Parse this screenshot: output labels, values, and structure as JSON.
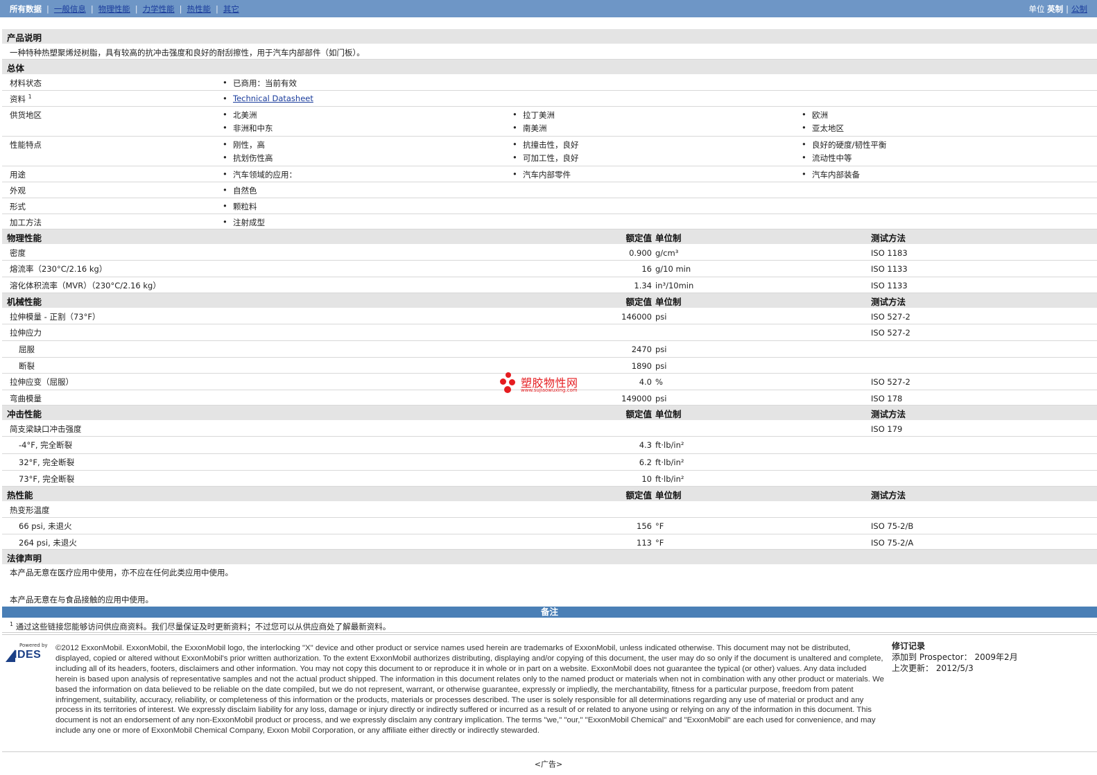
{
  "nav": {
    "tabs": [
      "所有数据",
      "一般信息",
      "物理性能",
      "力学性能",
      "热性能",
      "其它"
    ],
    "units_label": "单位",
    "unit_english": "英制",
    "unit_metric": "公制"
  },
  "product_description": {
    "title": "产品说明",
    "text": "一种特种热塑聚烯烃树脂，具有较高的抗冲击强度和良好的耐刮擦性，用于汽车内部部件（如门板）。"
  },
  "general": {
    "title": "总体",
    "rows": [
      {
        "label": "材料状态",
        "items": [
          "已商用：当前有效"
        ]
      },
      {
        "label": "资料",
        "sup": "1",
        "items": [
          "Technical Datasheet"
        ]
      },
      {
        "label": "供货地区",
        "items": [
          "北美洲",
          "拉丁美洲",
          "欧洲",
          "非洲和中东",
          "南美洲",
          "亚太地区"
        ]
      },
      {
        "label": "性能特点",
        "items": [
          "刚性，高",
          "抗撞击性，良好",
          "良好的硬度/韧性平衡",
          "抗划伤性高",
          "可加工性，良好",
          "流动性中等"
        ]
      },
      {
        "label": "用途",
        "items": [
          "汽车领域的应用：",
          "汽车内部零件",
          "汽车内部装备"
        ]
      },
      {
        "label": "外观",
        "items": [
          "自然色"
        ]
      },
      {
        "label": "形式",
        "items": [
          "颗粒料"
        ]
      },
      {
        "label": "加工方法",
        "items": [
          "注射成型"
        ]
      }
    ]
  },
  "headers": {
    "value": "额定值",
    "unit": "单位制",
    "method": "测试方法"
  },
  "physical": {
    "title": "物理性能",
    "rows": [
      {
        "label": "密度",
        "value": "0.900",
        "unit": "g/cm³",
        "method": "ISO 1183"
      },
      {
        "label": "熔流率（230°C/2.16 kg）",
        "value": "16",
        "unit": "g/10 min",
        "method": "ISO 1133"
      },
      {
        "label": "溶化体积流率（MVR）（230°C/2.16 kg）",
        "value": "1.34",
        "unit": "in³/10min",
        "method": "ISO 1133"
      }
    ]
  },
  "mechanical": {
    "title": "机械性能",
    "rows": [
      {
        "label": "拉伸模量 - 正割（73°F）",
        "value": "146000",
        "unit": "psi",
        "method": "ISO 527-2"
      },
      {
        "label": "拉伸应力",
        "value": "",
        "unit": "",
        "method": "ISO 527-2"
      },
      {
        "label": "屈服",
        "indent": true,
        "value": "2470",
        "unit": "psi",
        "method": ""
      },
      {
        "label": "断裂",
        "indent": true,
        "value": "1890",
        "unit": "psi",
        "method": ""
      },
      {
        "label": "拉伸应变（屈服）",
        "value": "4.0",
        "unit": "%",
        "method": "ISO 527-2"
      },
      {
        "label": "弯曲模量",
        "value": "149000",
        "unit": "psi",
        "method": "ISO 178"
      }
    ]
  },
  "impact": {
    "title": "冲击性能",
    "rows": [
      {
        "label": "简支梁缺口冲击强度",
        "value": "",
        "unit": "",
        "method": "ISO 179"
      },
      {
        "label": "-4°F, 完全断裂",
        "indent": true,
        "value": "4.3",
        "unit": "ft·lb/in²",
        "method": ""
      },
      {
        "label": "32°F, 完全断裂",
        "indent": true,
        "value": "6.2",
        "unit": "ft·lb/in²",
        "method": ""
      },
      {
        "label": "73°F, 完全断裂",
        "indent": true,
        "value": "10",
        "unit": "ft·lb/in²",
        "method": ""
      }
    ]
  },
  "thermal": {
    "title": "热性能",
    "rows": [
      {
        "label": "热变形温度",
        "value": "",
        "unit": "",
        "method": ""
      },
      {
        "label": "66 psi, 未退火",
        "indent": true,
        "value": "156",
        "unit": "°F",
        "method": "ISO 75-2/B"
      },
      {
        "label": "264 psi, 未退火",
        "indent": true,
        "value": "113",
        "unit": "°F",
        "method": "ISO 75-2/A"
      }
    ]
  },
  "legal_statement": {
    "title": "法律声明",
    "line1": "本产品无意在医疗应用中使用，亦不应在任何此类应用中使用。",
    "line2": "本产品无意在与食品接触的应用中使用。"
  },
  "notes": {
    "title": "备注",
    "sup": "1",
    "text": "通过这些链接您能够访问供应商资料。我们尽量保证及时更新资料；不过您可以从供应商处了解最新资料。"
  },
  "footer": {
    "logo_powered": "Powered by",
    "logo_brand": "IDES",
    "copyright": "©2012 ExxonMobil. ExxonMobil, the ExxonMobil logo, the interlocking \"X\" device and other product or service names used herein are trademarks of ExxonMobil, unless indicated otherwise. This document may not be distributed, displayed, copied or altered without ExxonMobil's prior written authorization. To the extent ExxonMobil authorizes distributing, displaying and/or copying of this document, the user may do so only if the document is unaltered and complete, including all of its headers, footers, disclaimers and other information. You may not copy this document to or reproduce it in whole or in part on a website. ExxonMobil does not guarantee the typical (or other) values. Any data included herein is based upon analysis of representative samples and not the actual product shipped. The information in this document relates only to the named product or materials when not in combination with any other product or materials. We based the information on data believed to be reliable on the date compiled, but we do not represent, warrant, or otherwise guarantee, expressly or impliedly, the merchantability, fitness for a particular purpose, freedom from patent infringement, suitability, accuracy, reliability, or completeness of this information or the products, materials or processes described. The user is solely responsible for all determinations regarding any use of material or product and any process in its territories of interest. We expressly disclaim liability for any loss, damage or injury directly or indirectly suffered or incurred as a result of or related to anyone using or relying on any of the information in this document. This document is not an endorsement of any non-ExxonMobil product or process, and we expressly disclaim any contrary implication. The terms \"we,\" \"our,\" \"ExxonMobil Chemical\" and \"ExxonMobil\" are each used for convenience, and may include any one or more of ExxonMobil Chemical Company, Exxon Mobil Corporation, or any affiliate either directly or indirectly stewarded.",
    "revision_title": "修订记录",
    "added_label": "添加到  Prospector：",
    "added_date": "2009年2月",
    "updated_label": "上次更新：",
    "updated_date": "2012/5/3",
    "ad": "<广告>"
  },
  "watermark": {
    "cn": "塑胶物性网",
    "en": "www.sujiaowuxing.com"
  }
}
